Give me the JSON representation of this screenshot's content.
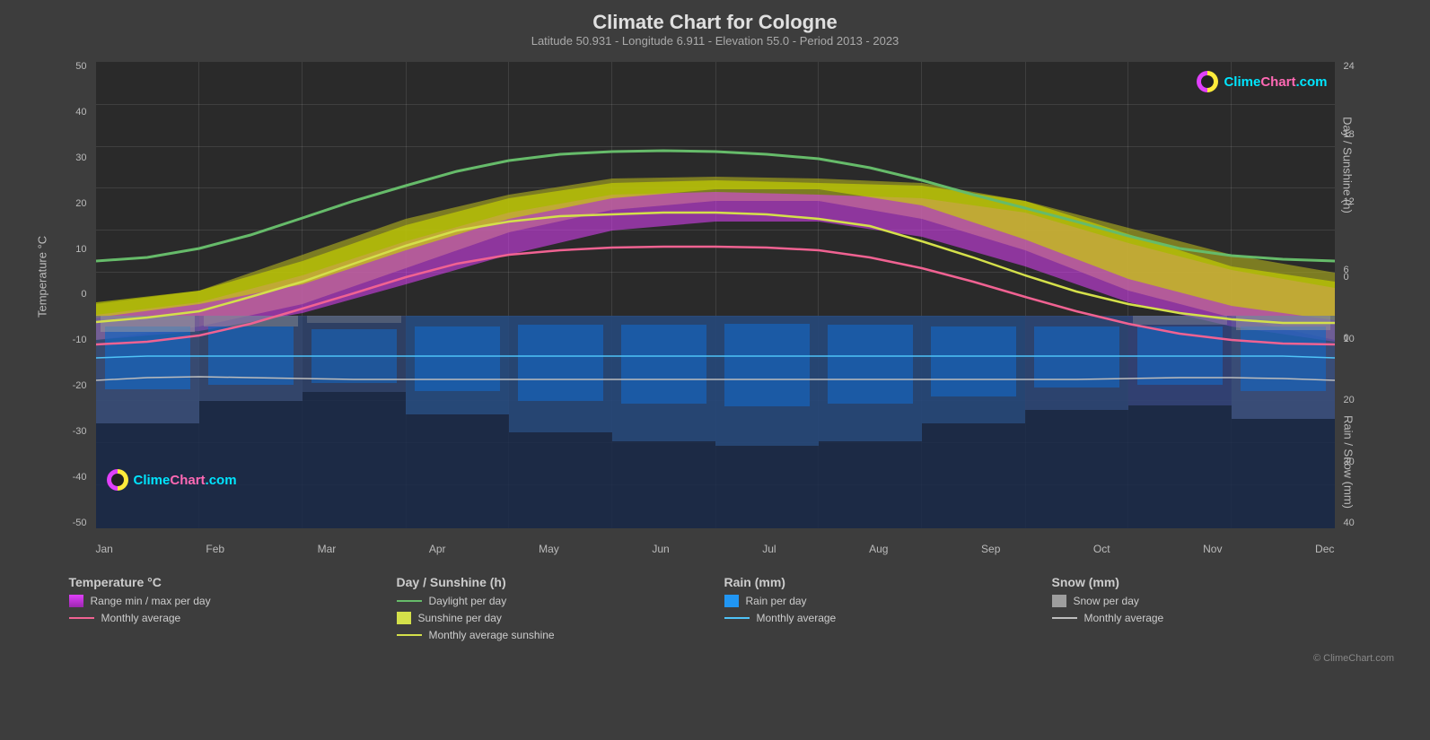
{
  "page": {
    "title": "Climate Chart for Cologne",
    "subtitle": "Latitude 50.931 - Longitude 6.911 - Elevation 55.0 - Period 2013 - 2023"
  },
  "chart": {
    "yaxis_left": {
      "label": "Temperature °C",
      "values": [
        "50",
        "40",
        "30",
        "20",
        "10",
        "0",
        "-10",
        "-20",
        "-30",
        "-40",
        "-50"
      ]
    },
    "yaxis_right_top": {
      "label": "Day / Sunshine (h)",
      "values": [
        "24",
        "18",
        "12",
        "6",
        "0"
      ]
    },
    "yaxis_right_bottom": {
      "label": "Rain / Snow (mm)",
      "values": [
        "0",
        "10",
        "20",
        "30",
        "40"
      ]
    },
    "xaxis": {
      "months": [
        "Jan",
        "Feb",
        "Mar",
        "Apr",
        "May",
        "Jun",
        "Jul",
        "Aug",
        "Sep",
        "Oct",
        "Nov",
        "Dec"
      ]
    }
  },
  "legend": {
    "sections": [
      {
        "title": "Temperature °C",
        "items": [
          {
            "type": "box",
            "color": "#e040fb",
            "label": "Range min / max per day"
          },
          {
            "type": "line",
            "color": "#e040fb",
            "label": "Monthly average"
          }
        ]
      },
      {
        "title": "Day / Sunshine (h)",
        "items": [
          {
            "type": "line",
            "color": "#66bb6a",
            "label": "Daylight per day"
          },
          {
            "type": "box",
            "color": "#d4e04a",
            "label": "Sunshine per day"
          },
          {
            "type": "line",
            "color": "#d4e04a",
            "label": "Monthly average sunshine"
          }
        ]
      },
      {
        "title": "Rain (mm)",
        "items": [
          {
            "type": "box",
            "color": "#2196f3",
            "label": "Rain per day"
          },
          {
            "type": "line",
            "color": "#4fc3f7",
            "label": "Monthly average"
          }
        ]
      },
      {
        "title": "Snow (mm)",
        "items": [
          {
            "type": "box",
            "color": "#9e9e9e",
            "label": "Snow per day"
          },
          {
            "type": "line",
            "color": "#bdbdbd",
            "label": "Monthly average"
          }
        ]
      }
    ]
  },
  "logo": {
    "text": "ClimeChart.com",
    "copyright": "© ClimeChart.com"
  }
}
